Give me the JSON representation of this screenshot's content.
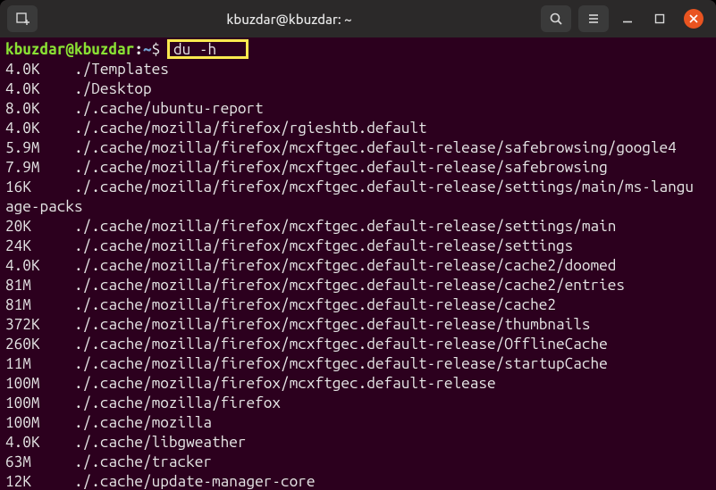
{
  "titlebar": {
    "title": "kbuzdar@kbuzdar: ~"
  },
  "prompt": {
    "user": "kbuzdar@kbuzdar",
    "sep": ":",
    "path": "~",
    "symbol": "$"
  },
  "command": "du -h",
  "output": [
    {
      "size": "4.0K",
      "path": "./Templates"
    },
    {
      "size": "4.0K",
      "path": "./Desktop"
    },
    {
      "size": "8.0K",
      "path": "./.cache/ubuntu-report"
    },
    {
      "size": "4.0K",
      "path": "./.cache/mozilla/firefox/rgieshtb.default"
    },
    {
      "size": "5.9M",
      "path": "./.cache/mozilla/firefox/mcxftgec.default-release/safebrowsing/google4"
    },
    {
      "size": "7.9M",
      "path": "./.cache/mozilla/firefox/mcxftgec.default-release/safebrowsing"
    },
    {
      "size": "16K",
      "path": "./.cache/mozilla/firefox/mcxftgec.default-release/settings/main/ms-language-packs",
      "wrap": true
    },
    {
      "size": "20K",
      "path": "./.cache/mozilla/firefox/mcxftgec.default-release/settings/main"
    },
    {
      "size": "24K",
      "path": "./.cache/mozilla/firefox/mcxftgec.default-release/settings"
    },
    {
      "size": "4.0K",
      "path": "./.cache/mozilla/firefox/mcxftgec.default-release/cache2/doomed"
    },
    {
      "size": "81M",
      "path": "./.cache/mozilla/firefox/mcxftgec.default-release/cache2/entries"
    },
    {
      "size": "81M",
      "path": "./.cache/mozilla/firefox/mcxftgec.default-release/cache2"
    },
    {
      "size": "372K",
      "path": "./.cache/mozilla/firefox/mcxftgec.default-release/thumbnails"
    },
    {
      "size": "260K",
      "path": "./.cache/mozilla/firefox/mcxftgec.default-release/OfflineCache"
    },
    {
      "size": "11M",
      "path": "./.cache/mozilla/firefox/mcxftgec.default-release/startupCache"
    },
    {
      "size": "100M",
      "path": "./.cache/mozilla/firefox/mcxftgec.default-release"
    },
    {
      "size": "100M",
      "path": "./.cache/mozilla/firefox"
    },
    {
      "size": "100M",
      "path": "./.cache/mozilla"
    },
    {
      "size": "4.0K",
      "path": "./.cache/libgweather"
    },
    {
      "size": "63M",
      "path": "./.cache/tracker"
    },
    {
      "size": "12K",
      "path": "./.cache/update-manager-core"
    }
  ]
}
